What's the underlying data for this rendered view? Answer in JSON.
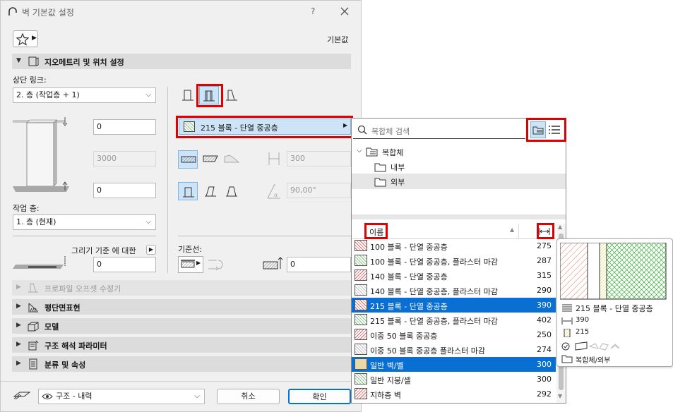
{
  "title": "벽 기본값 설정",
  "title_help": "?",
  "defaults_label": "기본값",
  "sections": {
    "geometry": "지오메트리 및 위치 설정",
    "profile_offset": "프로파일 오프셋 수정기",
    "floor_plan": "평단면표현",
    "model": "모델",
    "structural": "구조 해석 파라미터",
    "classification": "분류 및 속성"
  },
  "geometry": {
    "top_link_label": "상단 링크:",
    "top_link_value": "2. 층 (작업층 + 1)",
    "top_offset": "0",
    "height": "3000",
    "bottom_offset": "0",
    "home_story_label": "작업 층:",
    "home_story_value": "1. 층 (현재)",
    "relative_to_label": "그리기 기준 에 대한",
    "relative_value": "0",
    "composite_label": "215 블록 - 단열 중공층",
    "thickness_value": "300",
    "angle_value": "90,00°",
    "reference_line_label": "기준선:",
    "reference_offset": "0"
  },
  "footer": {
    "structure_value": "구조 - 내력",
    "cancel": "취소",
    "ok": "확인"
  },
  "picker": {
    "search_placeholder": "복합체 검색",
    "tree": [
      {
        "label": "복합체"
      },
      {
        "label": "내부"
      },
      {
        "label": "외부"
      }
    ],
    "col_name": "이름",
    "rows": [
      {
        "name": "100 블록 - 단열 중공층",
        "thickness": "275"
      },
      {
        "name": "100 블록 - 단열 중공층, 플라스터 마감",
        "thickness": "287"
      },
      {
        "name": "140 블록 - 단열 중공층",
        "thickness": "315"
      },
      {
        "name": "140 블록 - 단열 중공층, 플라스터 마감",
        "thickness": "290"
      },
      {
        "name": "215 블록 - 단열 중공층",
        "thickness": "390"
      },
      {
        "name": "215 블록 - 단열 중공층, 플라스터 마감",
        "thickness": "402"
      },
      {
        "name": "이중 50 블록 중공층",
        "thickness": "250"
      },
      {
        "name": "이중 50 블록 중공층 플라스터 마감",
        "thickness": "274"
      },
      {
        "name": "일반 벽/벨",
        "thickness": "300"
      },
      {
        "name": "일반 지붕/셸",
        "thickness": "300"
      },
      {
        "name": "지하층 벽",
        "thickness": "292"
      }
    ]
  },
  "preview": {
    "name": "215 블록 - 단열 중공층",
    "thickness": "390",
    "skins": "215",
    "path": "복합체/외부"
  },
  "colors": {
    "selection": "#0a6fd2",
    "highlight_box": "#e00000",
    "section_bg": "#dcdcdc"
  }
}
